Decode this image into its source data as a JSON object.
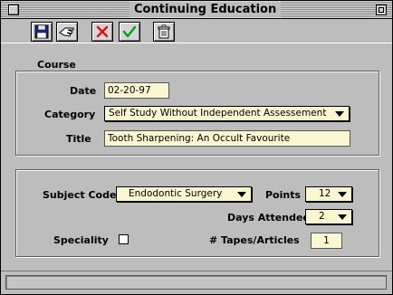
{
  "window": {
    "title": "Continuing Education"
  },
  "toolbar": {
    "buttons": [
      {
        "name": "save-button",
        "icon": "floppy-disk-icon"
      },
      {
        "name": "edit-button",
        "icon": "hand-pointer-icon"
      },
      {
        "name": "delete-button",
        "icon": "red-x-icon"
      },
      {
        "name": "ok-button",
        "icon": "green-check-icon"
      },
      {
        "name": "trash-button",
        "icon": "trash-can-icon"
      }
    ]
  },
  "course": {
    "heading": "Course",
    "date_label": "Date",
    "date_value": "02-20-97",
    "category_label": "Category",
    "category_value": "Self Study Without Independent Assessement",
    "title_label": "Title",
    "title_value": "Tooth Sharpening: An Occult Favourite"
  },
  "details": {
    "subject_label": "Subject Code",
    "subject_value": "Endodontic Surgery",
    "points_label": "Points",
    "points_value": "12",
    "days_label": "Days Attended",
    "days_value": "2",
    "speciality_label": "Speciality",
    "speciality_checked": false,
    "tapes_label": "# Tapes/Articles",
    "tapes_value": "1"
  },
  "colors": {
    "field_bg": "#fbf6d2",
    "window_bg": "#bdbdbd",
    "delete_red": "#e01010",
    "ok_green": "#129c2a"
  }
}
